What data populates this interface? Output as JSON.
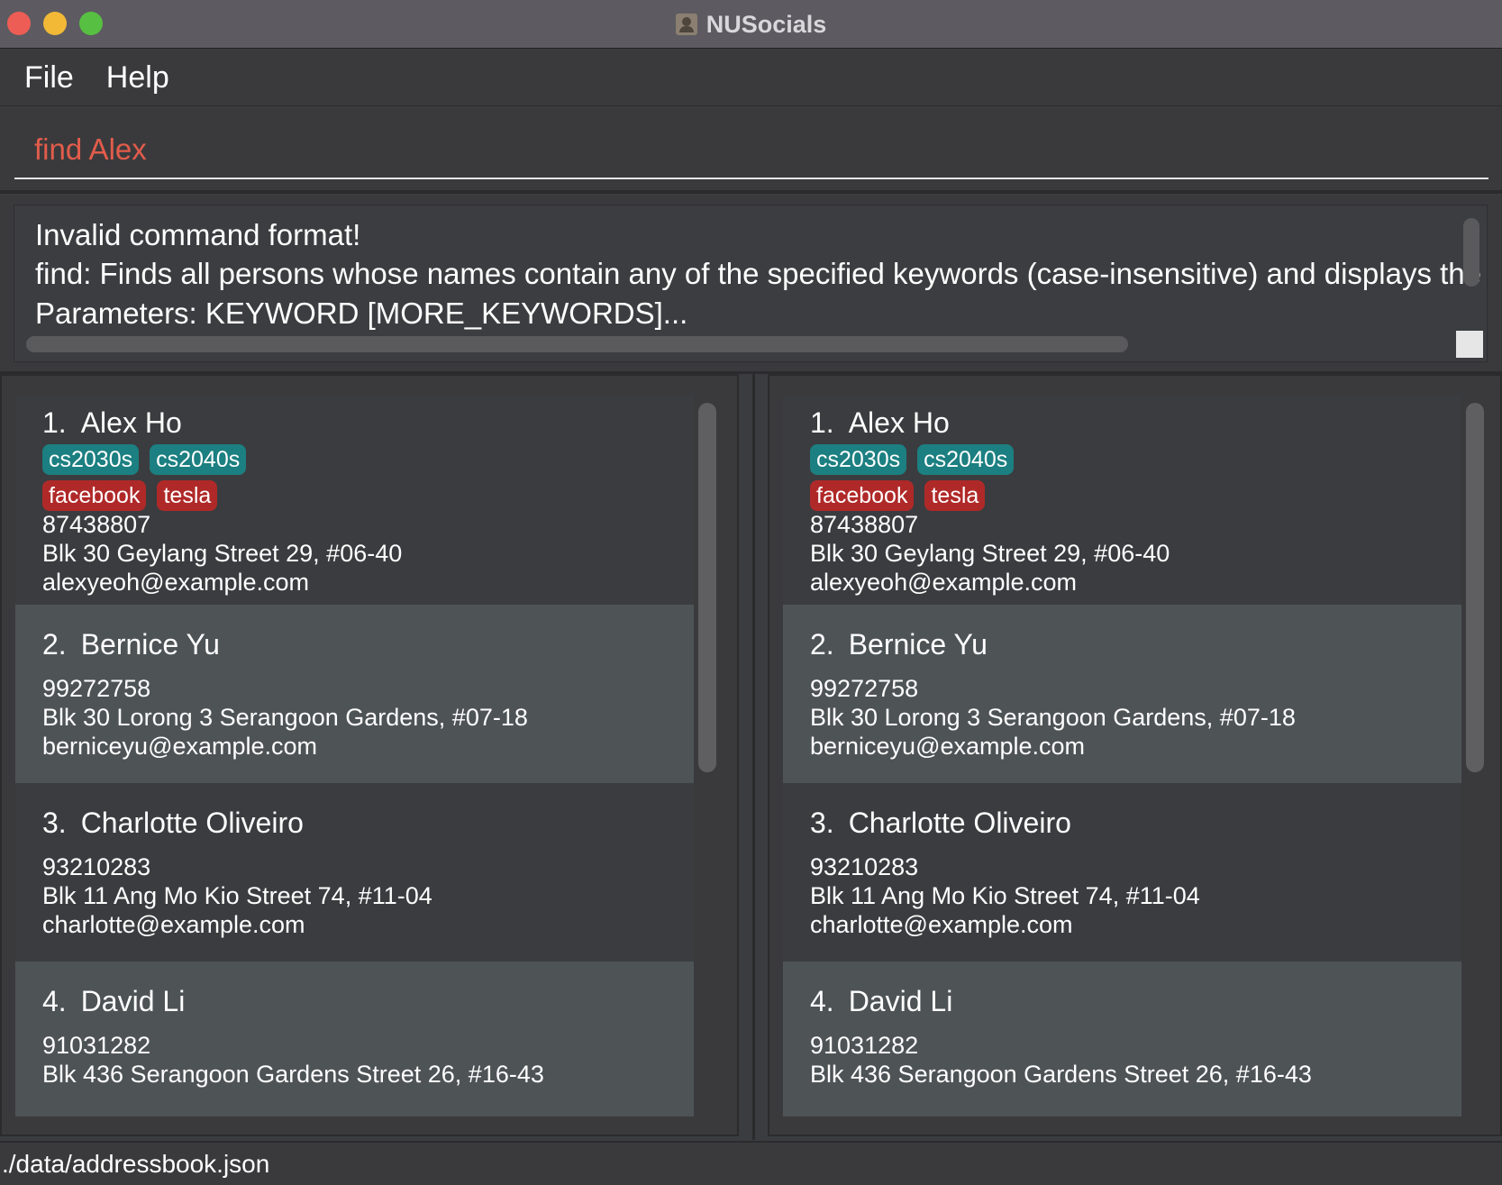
{
  "window": {
    "title": "NUSocials"
  },
  "menu": {
    "file": "File",
    "help": "Help"
  },
  "command": {
    "value": "find Alex"
  },
  "result": {
    "line1": "Invalid command format!",
    "line2": "find: Finds all persons whose names contain any of the specified keywords (case-insensitive) and displays the",
    "line3": "Parameters: KEYWORD [MORE_KEYWORDS]..."
  },
  "persons": [
    {
      "index": "1.",
      "name": "Alex Ho",
      "tags": [
        "cs2030s",
        "cs2040s"
      ],
      "companies": [
        "facebook",
        "tesla"
      ],
      "phone": "87438807",
      "address": "Blk 30 Geylang Street 29, #06-40",
      "email": "alexyeoh@example.com"
    },
    {
      "index": "2.",
      "name": "Bernice Yu",
      "phone": "99272758",
      "address": "Blk 30 Lorong 3 Serangoon Gardens, #07-18",
      "email": "berniceyu@example.com"
    },
    {
      "index": "3.",
      "name": "Charlotte Oliveiro",
      "phone": "93210283",
      "address": "Blk 11 Ang Mo Kio Street 74, #11-04",
      "email": "charlotte@example.com"
    },
    {
      "index": "4.",
      "name": "David Li",
      "phone": "91031282",
      "address": "Blk 436 Serangoon Gardens Street 26, #16-43"
    }
  ],
  "status": {
    "path": "./data/addressbook.json"
  },
  "colors": {
    "command_text": "#e25c4b",
    "tag_teal": "#1c7f81",
    "tag_red": "#b02929",
    "card_dark": "#3b3c3f",
    "card_light": "#4e5356"
  }
}
